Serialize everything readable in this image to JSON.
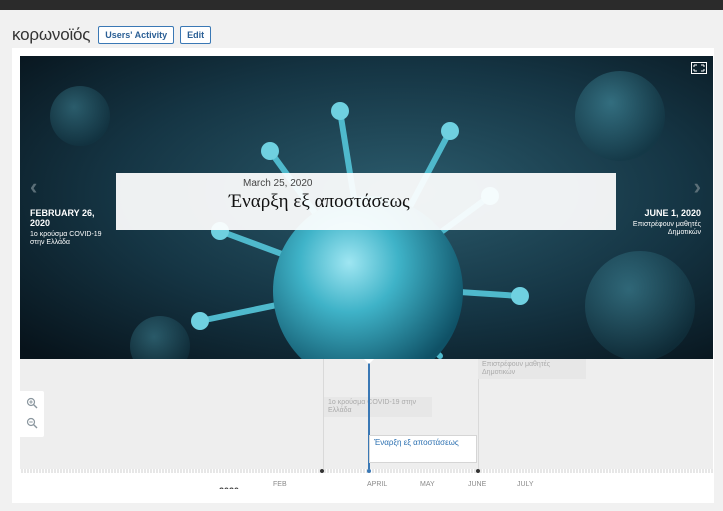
{
  "header": {
    "title": "κορωνοϊός",
    "buttons": {
      "users_activity": "Users' Activity",
      "edit": "Edit"
    }
  },
  "slide": {
    "prev": {
      "date": "FEBRUARY 26, 2020",
      "text": "1ο κρούσμα COVID-19 στην Ελλάδα"
    },
    "current": {
      "date": "March 25, 2020",
      "headline": "Έναρξη εξ αποστάσεως"
    },
    "next": {
      "date": "JUNE 1, 2020",
      "text": "Επιστρέφουν μαθητές Δημοτικών"
    }
  },
  "timeline": {
    "markers": {
      "m1": "1ο κρούσμα COVID-19 στην Ελλάδα",
      "m2": "Έναρξη εξ αποστάσεως",
      "m3": "Επιστρέφουν μαθητές Δημοτικών"
    },
    "months": {
      "feb": "FEB",
      "apr": "APRIL",
      "may": "MAY",
      "jun": "JUNE",
      "jul": "JULY"
    },
    "year": "2020"
  },
  "icons": {
    "fullscreen": "fullscreen-icon",
    "prev": "chevron-left-icon",
    "next": "chevron-right-icon",
    "zoom_in": "zoom-in-icon",
    "zoom_out": "zoom-out-icon"
  },
  "colors": {
    "accent": "#3a78b5",
    "topbar": "#2b2b2b"
  }
}
